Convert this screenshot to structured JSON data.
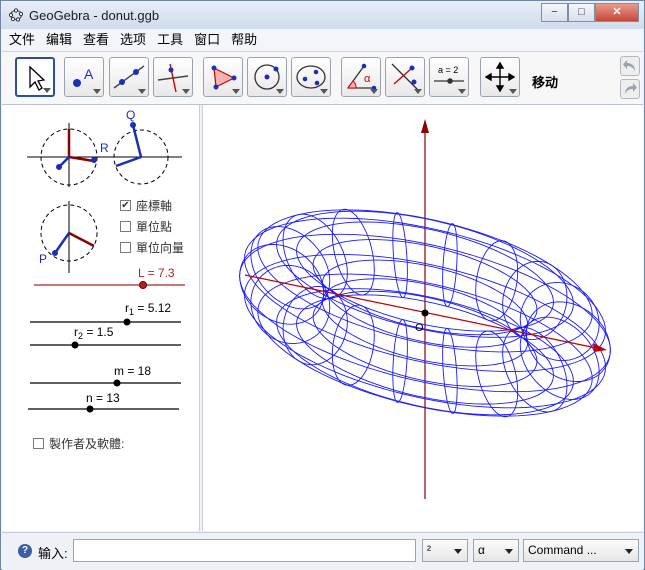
{
  "window": {
    "title": "GeoGebra - donut.ggb",
    "controls": {
      "minimize": "−",
      "maximize": "□",
      "close": "✕"
    }
  },
  "menu": [
    "文件",
    "编辑",
    "查看",
    "选项",
    "工具",
    "窗口",
    "帮助"
  ],
  "toolbar": {
    "tools": [
      {
        "name": "move-tool",
        "icon": "arrow-pointer-icon",
        "selected": true
      },
      {
        "name": "point-tool",
        "icon": "point-a-icon",
        "text": "A"
      },
      {
        "name": "line-tool",
        "icon": "line-through-points-icon"
      },
      {
        "name": "perpendicular-tool",
        "icon": "perpendicular-line-icon"
      },
      {
        "name": "polygon-tool",
        "icon": "polygon-icon"
      },
      {
        "name": "circle-tool",
        "icon": "circle-center-point-icon"
      },
      {
        "name": "conic-tool",
        "icon": "ellipse-icon"
      },
      {
        "name": "angle-tool",
        "icon": "angle-icon",
        "text": "α"
      },
      {
        "name": "reflect-tool",
        "icon": "reflect-line-icon"
      },
      {
        "name": "slider-tool",
        "icon": "slider-icon",
        "text": "a = 2"
      },
      {
        "name": "move-view-tool",
        "icon": "move-graphics-view-icon"
      }
    ],
    "active_label": "移动"
  },
  "algebra": {
    "points": {
      "Q": "Q",
      "R": "R",
      "P": "P"
    },
    "checkboxes": [
      {
        "label": "座標軸",
        "checked": true
      },
      {
        "label": "單位點",
        "checked": false
      },
      {
        "label": "單位向量",
        "checked": false
      }
    ],
    "sliders": [
      {
        "label": "L = 7.3",
        "value": 7.3,
        "color": "#b22222"
      },
      {
        "label_main": "r",
        "label_sub": "1",
        "label_rest": " = 5.12",
        "value": 5.12
      },
      {
        "label_main": "r",
        "label_sub": "2",
        "label_rest": " = 1.5",
        "value": 1.5
      },
      {
        "label": "m = 18",
        "value": 18
      },
      {
        "label": "n = 13",
        "value": 13
      }
    ],
    "author_checkbox": {
      "label": "製作者及軟體:",
      "checked": false
    }
  },
  "graphics": {
    "origin_label": "O",
    "torus_color": "#1a1aff",
    "axis_color": "#c00000",
    "vertical_axis_color": "#8b0000"
  },
  "inputbar": {
    "help": "?",
    "label": "输入:",
    "value": "",
    "dropdowns": [
      "²",
      "α",
      "Command ..."
    ]
  }
}
